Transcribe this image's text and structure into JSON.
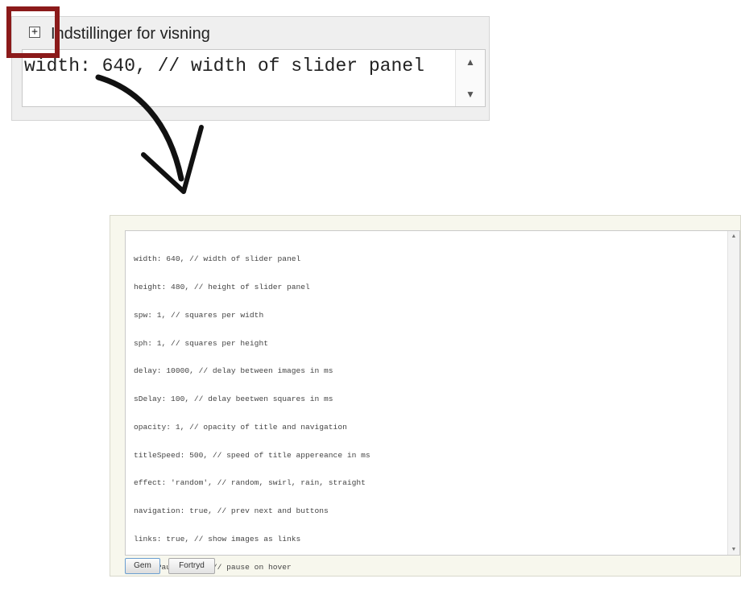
{
  "top_panel": {
    "expand_symbol": "+",
    "title": "Indstillinger for visning",
    "code": "width: 640, // width of slider panel",
    "scroll_up": "▲",
    "scroll_down": "▼"
  },
  "bottom_panel": {
    "code_lines": [
      "width: 640, // width of slider panel",
      "height: 480, // height of slider panel",
      "spw: 1, // squares per width",
      "sph: 1, // squares per height",
      "delay: 10000, // delay between images in ms",
      "sDelay: 100, // delay beetwen squares in ms",
      "opacity: 1, // opacity of title and navigation",
      "titleSpeed: 500, // speed of title appereance in ms",
      "effect: 'random', // random, swirl, rain, straight",
      "navigation: true, // prev next and buttons",
      "links: true, // show images as links",
      "hoverPause: true // pause on hover"
    ],
    "save_label": "Gem",
    "cancel_label": "Fortryd",
    "scroll_up": "▲",
    "scroll_down": "▼"
  },
  "colors": {
    "highlight": "#8b1a1a",
    "panel_bg": "#f7f7ed"
  }
}
